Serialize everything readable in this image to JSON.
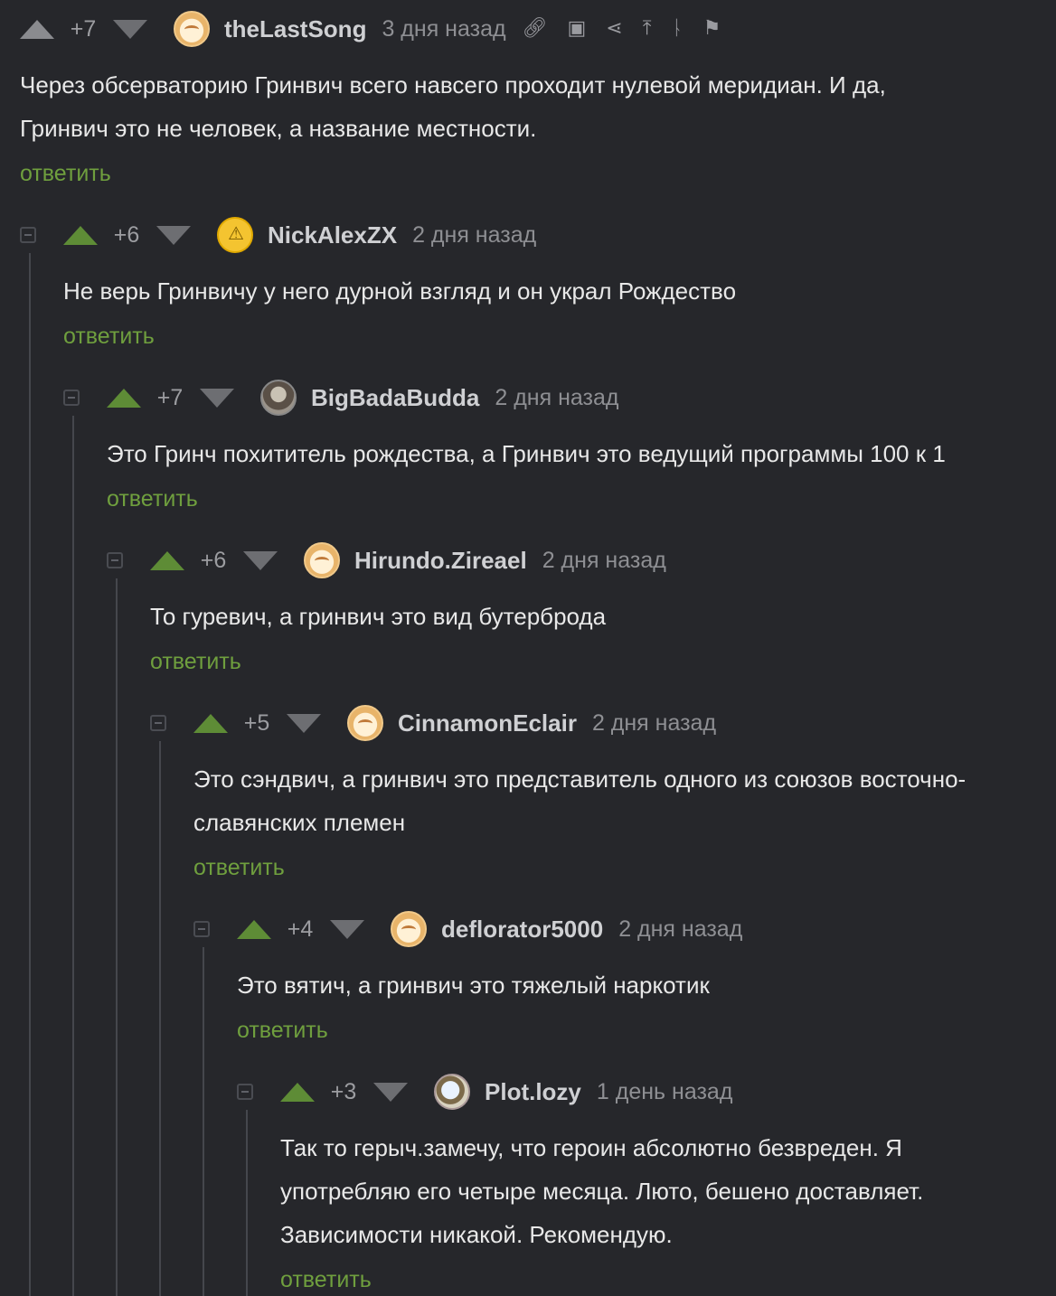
{
  "labels": {
    "reply": "ответить"
  },
  "colors": {
    "background": "#26272b",
    "upvote": "#5e8c36",
    "reply_link": "#6f9f3e",
    "thread_line": "#45474d"
  },
  "toolbar_icons": [
    "link-icon",
    "save-icon",
    "share-icon",
    "scroll-top-icon",
    "branch-icon",
    "report-flag-icon"
  ],
  "comments": [
    {
      "rating": "+7",
      "username": "theLastSong",
      "time": "3 дня назад",
      "avatar": "pie-face",
      "lines": [
        "Через обсерваторию Гринвич всего навсего проходит нулевой меридиан. И да,",
        "Гринвич это не человек, а название местности."
      ]
    },
    {
      "rating": "+6",
      "username": "NickAlexZX",
      "time": "2 дня назад",
      "avatar": "warning",
      "lines": [
        "Не верь Гринвичу у него дурной взгляд и он украл Рождество"
      ]
    },
    {
      "rating": "+7",
      "username": "BigBadaBudda",
      "time": "2 дня назад",
      "avatar": "photo",
      "lines": [
        "Это Гринч похититель рождества, а Гринвич это ведущий программы 100 к 1"
      ]
    },
    {
      "rating": "+6",
      "username": "Hirundo.Zireael",
      "time": "2 дня назад",
      "avatar": "pie-face",
      "lines": [
        "То гуревич, а гринвич это вид бутерброда"
      ]
    },
    {
      "rating": "+5",
      "username": "CinnamonEclair",
      "time": "2 дня назад",
      "avatar": "pie-face",
      "lines": [
        "Это сэндвич, а гринвич это представитель одного из союзов восточно-",
        "славянских племен"
      ]
    },
    {
      "rating": "+4",
      "username": "deflorator5000",
      "time": "2 дня назад",
      "avatar": "pie-face",
      "lines": [
        "Это вятич, а гринвич это тяжелый наркотик"
      ]
    },
    {
      "rating": "+3",
      "username": "Plot.lozy",
      "time": "1 день назад",
      "avatar": "cartoon",
      "lines": [
        "Так то герыч.замечу, что героин абсолютно безвреден. Я",
        "употребляю его четыре месяца. Люто, бешено доставляет.",
        "Зависимости никакой. Рекомендую."
      ]
    }
  ]
}
